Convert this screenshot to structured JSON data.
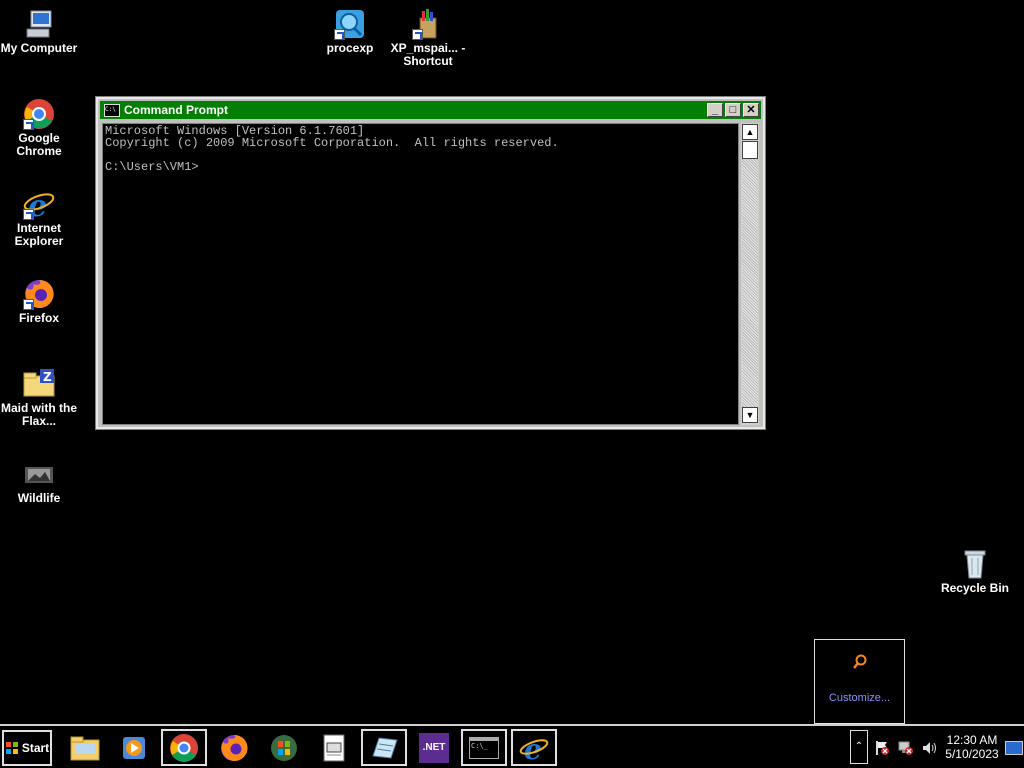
{
  "desktop": {
    "icons": {
      "my_computer": "My Computer",
      "chrome": "Google Chrome",
      "ie": "Internet Explorer",
      "firefox": "Firefox",
      "maid": "Maid with the Flax...",
      "wildlife": "Wildlife",
      "procexp": "procexp",
      "mspaint": "XP_mspai... - Shortcut",
      "recycle": "Recycle Bin"
    }
  },
  "cmd": {
    "title": "Command Prompt",
    "line1": "Microsoft Windows [Version 6.1.7601]",
    "line2": "Copyright (c) 2009 Microsoft Corporation.  All rights reserved.",
    "line3": "C:\\Users\\VM1>"
  },
  "tray_popup": {
    "customize": "Customize..."
  },
  "taskbar": {
    "start": "Start",
    "net_label": ".NET",
    "cmd_glyph": "C:\\_",
    "time": "12:30 AM",
    "date": "5/10/2023"
  },
  "colors": {
    "titlebar": "#038003",
    "desktop": "#000000"
  }
}
